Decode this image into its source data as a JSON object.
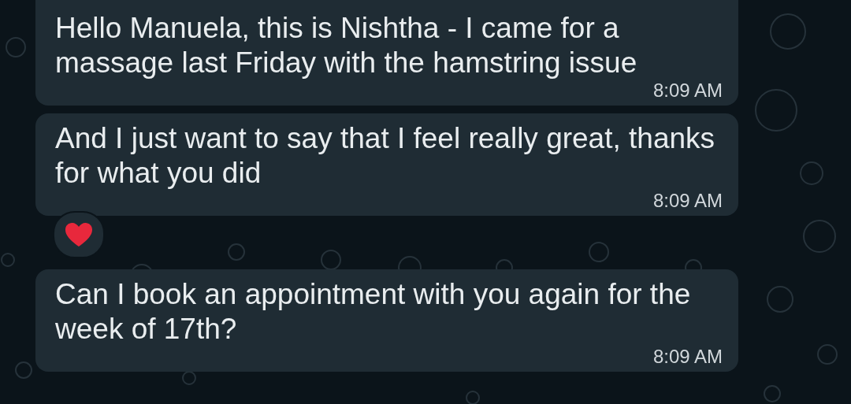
{
  "messages": [
    {
      "text": "Hello Manuela, this is Nishtha - I came for a massage last Friday with the hamstring issue",
      "time": "8:09 AM"
    },
    {
      "text": "And I just want to say that I feel really great, thanks for what you did",
      "time": "8:09 AM",
      "reaction": {
        "kind": "heart"
      }
    },
    {
      "text": "Can I book an appointment with you again for the week of 17th?",
      "time": "8:09 AM"
    }
  ]
}
